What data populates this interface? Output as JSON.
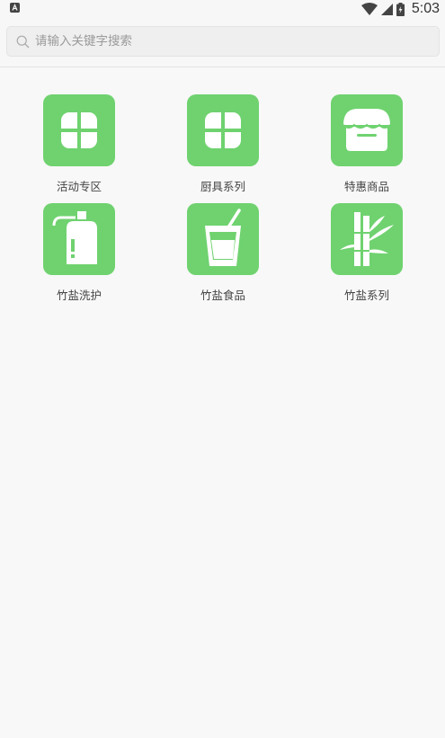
{
  "status_bar": {
    "time": "5:03"
  },
  "search": {
    "placeholder": "请输入关键字搜索"
  },
  "categories": [
    {
      "label": "活动专区",
      "icon": "clover-icon"
    },
    {
      "label": "厨具系列",
      "icon": "clover-icon"
    },
    {
      "label": "特惠商品",
      "icon": "store-icon"
    },
    {
      "label": "竹盐洗护",
      "icon": "lotion-bottle-icon"
    },
    {
      "label": "竹盐食品",
      "icon": "drink-cup-icon"
    },
    {
      "label": "竹盐系列",
      "icon": "bamboo-icon"
    }
  ],
  "colors": {
    "tile": "#6fd26f",
    "background": "#f8f8f8"
  }
}
